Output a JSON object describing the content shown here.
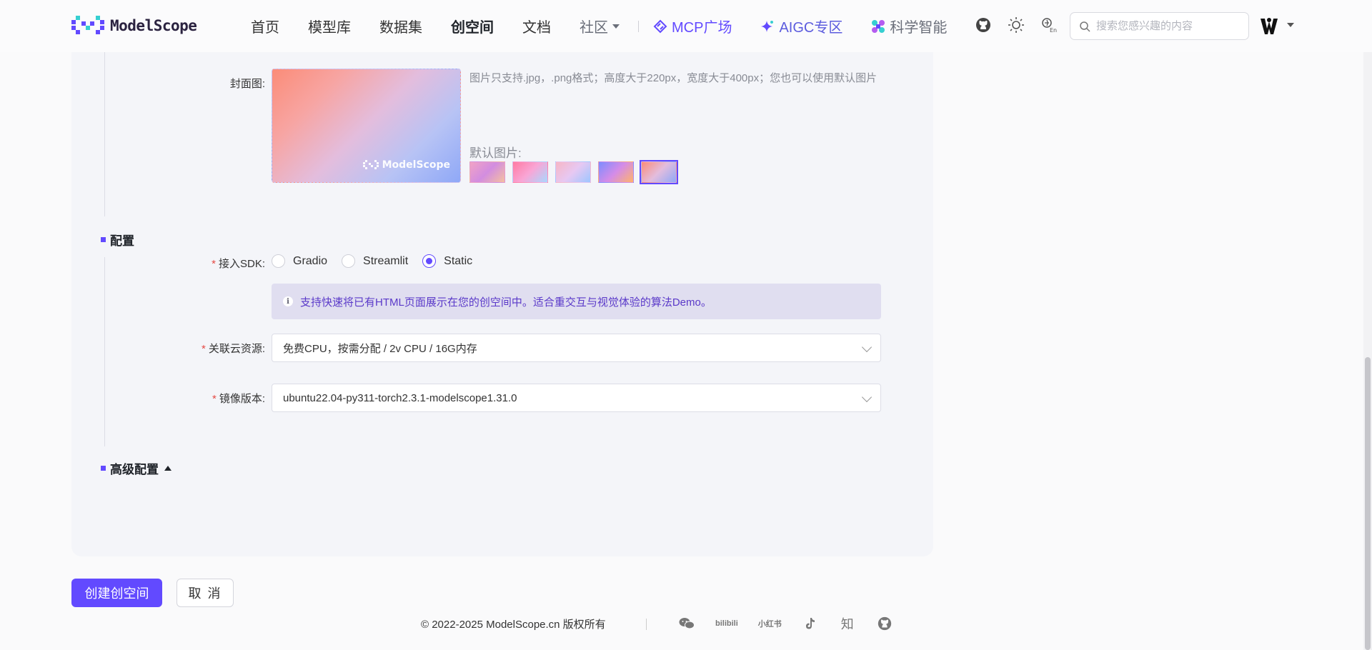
{
  "header": {
    "brand": "ModelScope",
    "nav": [
      {
        "label": "首页"
      },
      {
        "label": "模型库"
      },
      {
        "label": "数据集"
      },
      {
        "label": "创空间",
        "active": true
      },
      {
        "label": "文档"
      },
      {
        "label": "社区"
      }
    ],
    "special_nav": [
      {
        "label": "MCP广场",
        "icon": "mcp-icon"
      },
      {
        "label": "AIGC专区",
        "icon": "sparkle-icon"
      },
      {
        "label": "科学智能",
        "icon": "science-icon"
      }
    ],
    "search_placeholder": "搜索您感兴趣的内容"
  },
  "form": {
    "cover": {
      "label": "封面图:",
      "hint": "图片只支持.jpg，.png格式；高度大于220px，宽度大于400px；您也可以使用默认图片",
      "defaults_label": "默认图片:",
      "cover_logo_text": "ModelScope",
      "thumb_count": 5,
      "selected_thumb_index": 4
    },
    "config_section": "配置",
    "sdk": {
      "label": "接入SDK:",
      "options": [
        "Gradio",
        "Streamlit",
        "Static"
      ],
      "selected": "Static"
    },
    "info_text": "支持快速将已有HTML页面展示在您的创空间中。适合重交互与视觉体验的算法Demo。",
    "cloud": {
      "label": "关联云资源:",
      "value": "免费CPU，按需分配 / 2v CPU / 16G内存"
    },
    "image": {
      "label": "镜像版本:",
      "value": "ubuntu22.04-py311-torch2.3.1-modelscope1.31.0"
    },
    "advanced_section": "高级配置"
  },
  "buttons": {
    "create": "创建创空间",
    "cancel": "取 消"
  },
  "footer": {
    "copyright": "© 2022-2025 ModelScope.cn 版权所有",
    "icons": [
      "wechat-icon",
      "bilibili-icon",
      "xiaohongshu-icon",
      "douyin-icon",
      "zhihu-icon",
      "github-icon"
    ],
    "bilibili_text": "bilibili",
    "xhs_text": "小红书",
    "zhihu_text": "知"
  },
  "colors": {
    "accent": "#624aff",
    "info_bg": "#e0def0",
    "required": "#e54a44"
  }
}
